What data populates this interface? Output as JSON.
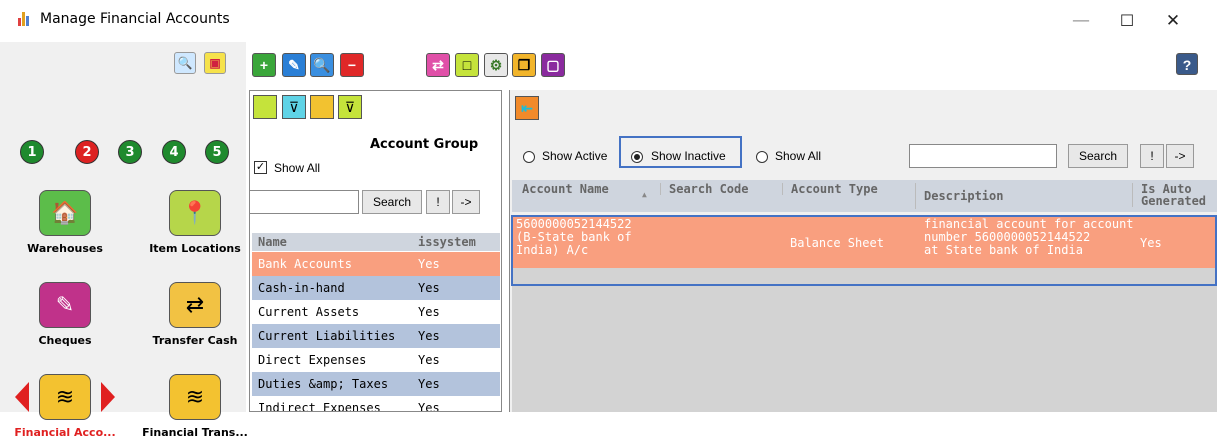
{
  "window": {
    "title": "Manage Financial Accounts",
    "minimize": "—",
    "maximize": "☐",
    "close": "✕"
  },
  "left_panel": {
    "number_buttons": [
      "1",
      "2",
      "3",
      "4",
      "5"
    ],
    "tiles": [
      {
        "label": "Warehouses",
        "icon": "warehouse-icon",
        "glyph": "🏠"
      },
      {
        "label": "Item Locations",
        "icon": "location-pin-icon",
        "glyph": "📍"
      },
      {
        "label": "Cheques",
        "icon": "cheque-icon",
        "glyph": "✎"
      },
      {
        "label": "Transfer Cash",
        "icon": "transfer-cash-icon",
        "glyph": "⇄"
      },
      {
        "label": "Financial Acco...",
        "icon": "financial-accounts-icon",
        "glyph": "≋"
      },
      {
        "label": "Financial Trans...",
        "icon": "financial-transactions-icon",
        "glyph": "≋"
      }
    ]
  },
  "toolbar": {
    "help": "?"
  },
  "account_group": {
    "title": "Account Group",
    "show_all_label": "Show All",
    "show_all_checked": true,
    "search_value": "",
    "search_label": "Search",
    "bang_label": "!",
    "arrow_label": "->",
    "columns": [
      "Name",
      "issystem"
    ],
    "rows": [
      {
        "name": "Bank Accounts",
        "issystem": "Yes"
      },
      {
        "name": "Cash-in-hand",
        "issystem": "Yes"
      },
      {
        "name": "Current Assets",
        "issystem": "Yes"
      },
      {
        "name": "Current Liabilities",
        "issystem": "Yes"
      },
      {
        "name": "Direct Expenses",
        "issystem": "Yes"
      },
      {
        "name": "Duties &amp; Taxes",
        "issystem": "Yes"
      },
      {
        "name": "Indirect Expenses",
        "issystem": "Yes"
      }
    ]
  },
  "accounts": {
    "filter_active": "Show Active",
    "filter_inactive": "Show Inactive",
    "filter_all": "Show All",
    "selected_filter": "Show Inactive",
    "search_value": "",
    "search_label": "Search",
    "bang_label": "!",
    "arrow_label": "->",
    "columns": [
      "Account Name",
      "Search Code",
      "Account Type",
      "Description",
      "Is Auto Generated"
    ],
    "row": {
      "account_name": [
        "5600000052144522",
        "(B-State bank of",
        "India) A/c"
      ],
      "search_code": "",
      "account_type": "Balance Sheet",
      "description": [
        "financial account for account",
        "number 5600000052144522",
        "at State bank of India"
      ],
      "is_auto_generated": "Yes"
    }
  },
  "colors": {
    "selected_row": "#f99f7f",
    "alt_row": "#b3c3dc",
    "highlight_border": "#4472c4"
  }
}
